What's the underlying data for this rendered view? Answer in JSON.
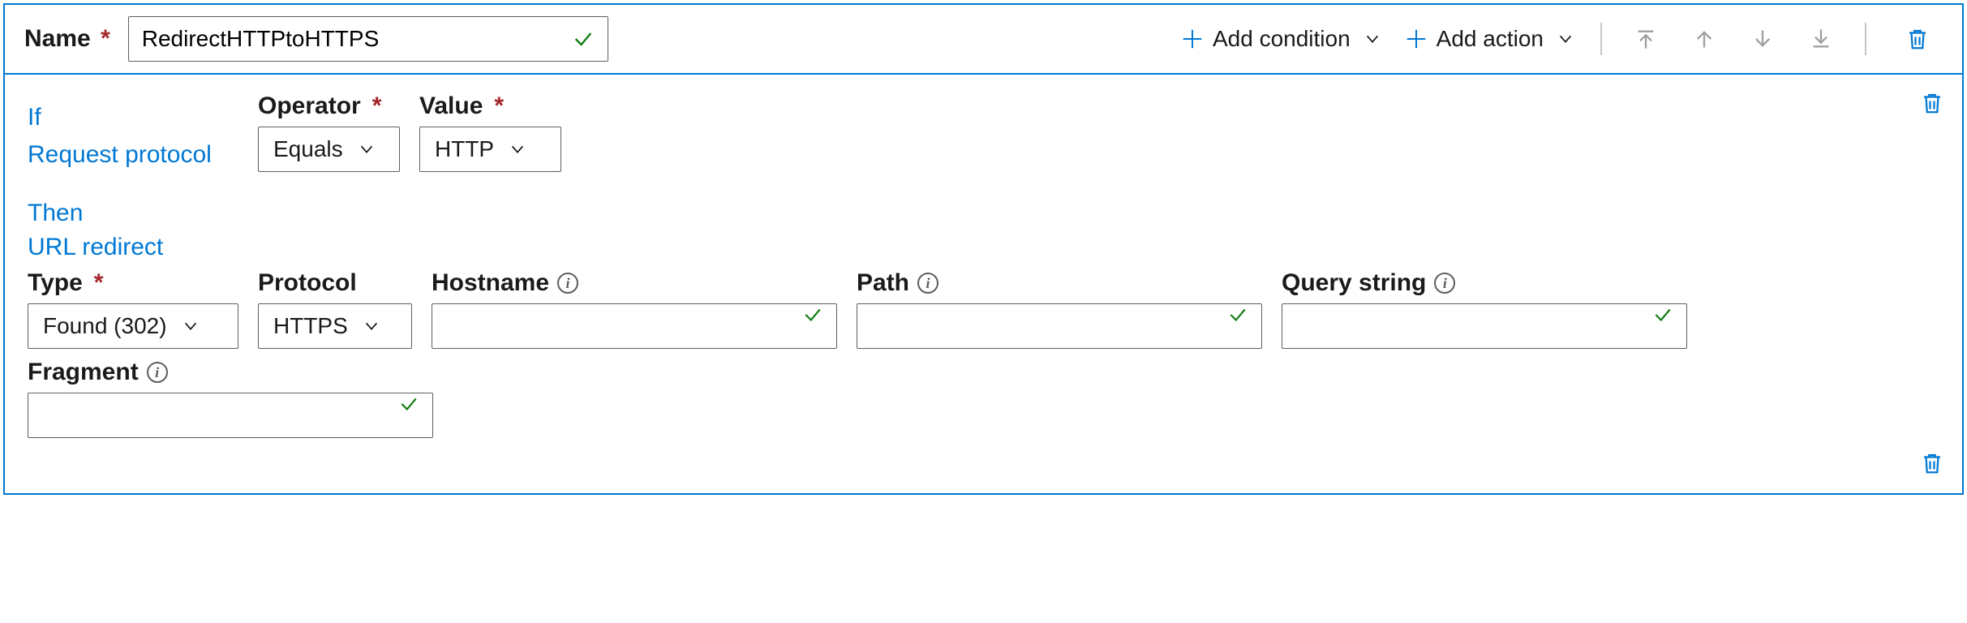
{
  "header": {
    "name_label": "Name",
    "name_value": "RedirectHTTPtoHTTPS",
    "add_condition_label": "Add condition",
    "add_action_label": "Add action"
  },
  "condition": {
    "if_label": "If",
    "type_label": "Request protocol",
    "operator_label": "Operator",
    "operator_value": "Equals",
    "value_label": "Value",
    "value_value": "HTTP"
  },
  "action": {
    "then_label": "Then",
    "type_label": "URL redirect",
    "redirect_type_label": "Type",
    "redirect_type_value": "Found (302)",
    "protocol_label": "Protocol",
    "protocol_value": "HTTPS",
    "hostname_label": "Hostname",
    "hostname_value": "",
    "path_label": "Path",
    "path_value": "",
    "querystring_label": "Query string",
    "querystring_value": "",
    "fragment_label": "Fragment",
    "fragment_value": ""
  }
}
